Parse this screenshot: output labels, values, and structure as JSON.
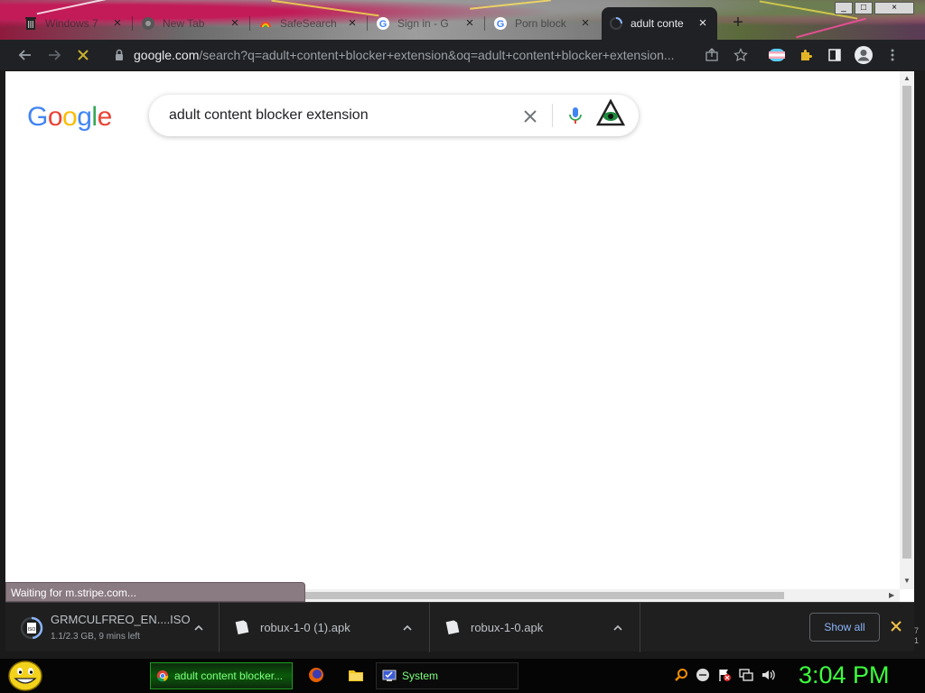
{
  "browser": {
    "tabs": [
      {
        "title": "Windows 7",
        "favicon": "windows-trash-icon",
        "active": false
      },
      {
        "title": "New Tab",
        "favicon": "chrome-icon",
        "active": false
      },
      {
        "title": "SafeSearch",
        "favicon": "safesearch-icon",
        "active": false
      },
      {
        "title": "Sign in - G",
        "favicon": "google-icon",
        "active": false
      },
      {
        "title": "Porn block",
        "favicon": "google-icon",
        "active": false
      },
      {
        "title": "adult conte",
        "favicon": "loading-spinner-icon",
        "active": true
      }
    ],
    "new_tab_symbol": "+",
    "window_controls": {
      "minimize": "_",
      "maximize": "□",
      "close": "×"
    },
    "url_host": "google.com",
    "url_path": "/search?q=adult+content+blocker+extension&oq=adult+content+blocker+extension..."
  },
  "page": {
    "logo": [
      "G",
      "o",
      "o",
      "g",
      "l",
      "e"
    ],
    "logo_colors": [
      "#4285f4",
      "#ea4335",
      "#fbbc05",
      "#4285f4",
      "#34a853",
      "#ea4335"
    ],
    "search_query": "adult content blocker extension",
    "status_text": "Waiting for m.stripe.com..."
  },
  "downloads": {
    "items": [
      {
        "name": "GRMCULFREO_EN....ISO",
        "status": "1.1/2.3 GB, 9 mins left",
        "icon": "iso-file-icon"
      },
      {
        "name": "robux-1-0 (1).apk",
        "status": "",
        "icon": "apk-file-icon"
      },
      {
        "name": "robux-1-0.apk",
        "status": "",
        "icon": "apk-file-icon"
      }
    ],
    "progress": 0.478,
    "show_all_label": "Show all"
  },
  "taskbar": {
    "tasks": [
      {
        "label": "adult content blocker...",
        "icon": "chrome-icon"
      },
      {
        "label": "System",
        "icon": "system-monitor-icon"
      }
    ],
    "clock": "3:04 PM",
    "clock_edge": "7\n1"
  },
  "colors": {
    "accent": "#8ab4f8",
    "taskbar_green": "#3cff3c",
    "toolbar_bg": "#202124"
  }
}
